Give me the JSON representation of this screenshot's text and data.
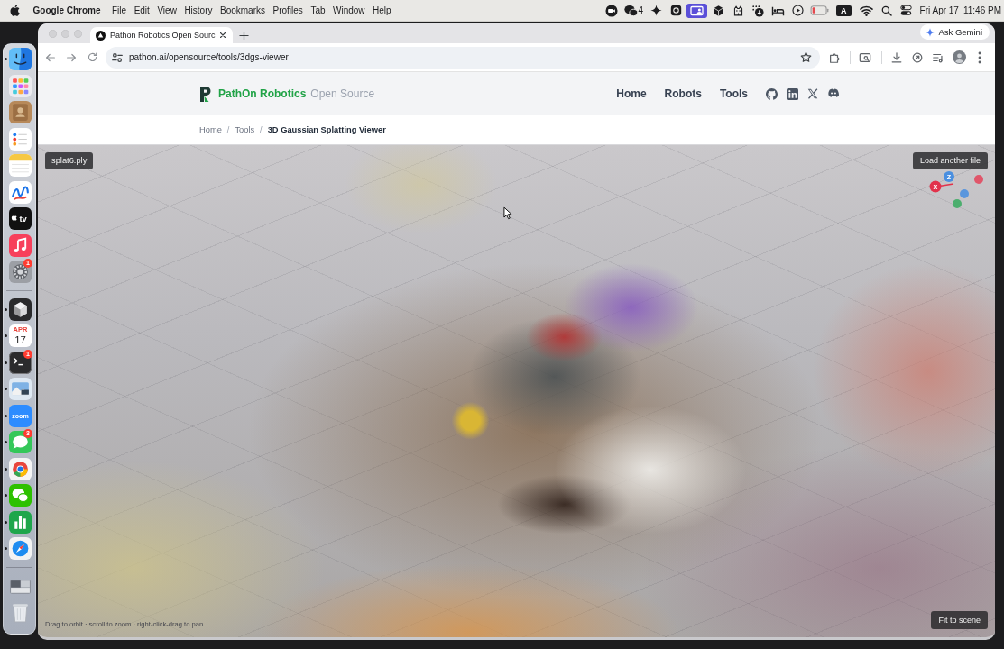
{
  "menu_bar": {
    "app_name": "Google Chrome",
    "menus": [
      "File",
      "Edit",
      "View",
      "History",
      "Bookmarks",
      "Profiles",
      "Tab",
      "Window",
      "Help"
    ],
    "chat_count": "4",
    "screen_share_active": true,
    "input_source": "A",
    "date": "Fri Apr 17",
    "time": "11:46 PM"
  },
  "dock": {
    "sections": [
      {
        "items": [
          {
            "kind": "finder",
            "running": true
          },
          {
            "kind": "launchpad",
            "running": false
          },
          {
            "kind": "contacts",
            "running": false
          },
          {
            "kind": "reminders",
            "running": false
          },
          {
            "kind": "notes",
            "running": false
          },
          {
            "kind": "freeform",
            "running": false
          },
          {
            "kind": "tv",
            "label": "tv",
            "running": false
          },
          {
            "kind": "music",
            "running": false
          },
          {
            "kind": "settings",
            "running": false,
            "badge": "1"
          }
        ]
      },
      {
        "items": [
          {
            "kind": "cube",
            "running": true
          },
          {
            "kind": "calendar",
            "month": "APR",
            "day": "17",
            "running": true
          },
          {
            "kind": "terminal",
            "running": true,
            "badge": "1"
          },
          {
            "kind": "preview",
            "running": true
          },
          {
            "kind": "zoom",
            "label": "zoom",
            "running": true
          },
          {
            "kind": "messages",
            "running": true,
            "badge": "3"
          },
          {
            "kind": "chrome",
            "running": true
          },
          {
            "kind": "wechat",
            "running": true
          },
          {
            "kind": "numbers",
            "running": true
          },
          {
            "kind": "safari",
            "running": true
          }
        ]
      },
      {
        "items": [
          {
            "kind": "stack"
          },
          {
            "kind": "trash"
          }
        ]
      }
    ]
  },
  "browser": {
    "tabs": [
      {
        "title": "Pathon Robotics Open Sourc",
        "selected": true
      }
    ],
    "ask_button": "Ask Gemini",
    "url": "pathon.ai/opensource/tools/3dgs-viewer"
  },
  "site_header": {
    "brand": {
      "name": "PathOn Robotics",
      "suffix": "Open Source"
    },
    "nav": [
      "Home",
      "Robots",
      "Tools"
    ]
  },
  "breadcrumb": {
    "items": [
      {
        "label": "Home",
        "current": false
      },
      {
        "label": "Tools",
        "current": false
      },
      {
        "label": "3D Gaussian Splatting Viewer",
        "current": true
      }
    ],
    "separators": [
      "/",
      "/"
    ]
  },
  "viewer": {
    "file_name": "splat6.ply",
    "load_button": "Load another file",
    "axes": [
      {
        "label": "Z",
        "color": "#4a8fe0"
      },
      {
        "label": "X",
        "color": "#e2324b"
      }
    ],
    "hint": "Drag to orbit · scroll to zoom · right-click-drag to pan",
    "fit_button": "Fit to scene"
  }
}
